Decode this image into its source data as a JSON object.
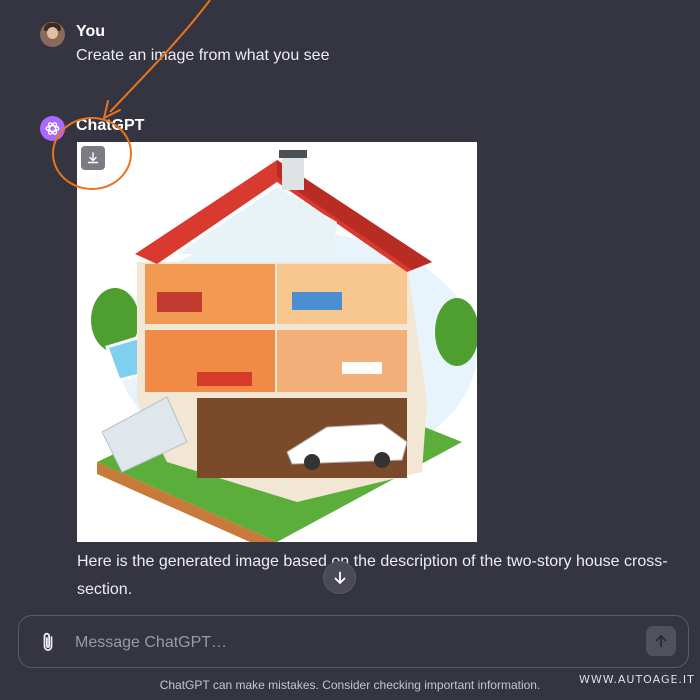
{
  "user_message": {
    "author": "You",
    "text": "Create an image from what you see"
  },
  "assistant_message": {
    "author": "ChatGPT",
    "image_alt": "Isometric cross-section of a two-story house",
    "response_line_1": "Here is the generated image based on the description of the two-story house cross-",
    "response_line_2": "section."
  },
  "composer": {
    "placeholder": "Message ChatGPT…"
  },
  "footer": {
    "disclaimer": "ChatGPT can make mistakes. Consider checking important information."
  },
  "watermark": "WWW.AUTOAGE.IT",
  "icons": {
    "download": "download-icon",
    "attach": "paperclip-icon",
    "send": "arrow-up-icon",
    "scroll": "arrow-down-icon",
    "logo": "openai-logo-icon"
  },
  "colors": {
    "background": "#343541",
    "callout": "#e8741c",
    "assistant_avatar": "#ab68ff"
  }
}
